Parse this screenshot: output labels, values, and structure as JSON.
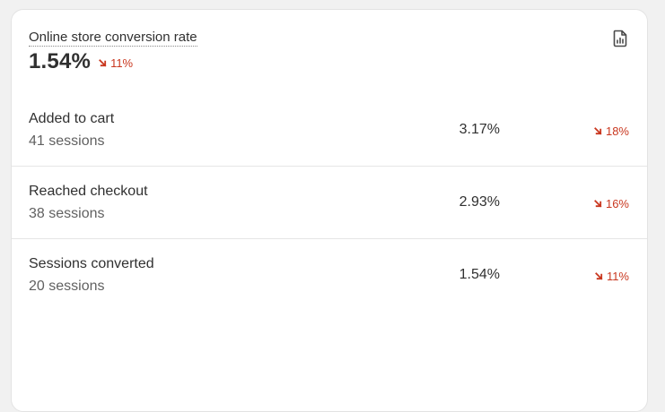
{
  "card": {
    "title": "Online store conversion rate",
    "value": "1.54%",
    "delta": "11%",
    "report_icon": "report-document-icon"
  },
  "rows": [
    {
      "label": "Added to cart",
      "sessions": "41 sessions",
      "value": "3.17%",
      "delta": "18%"
    },
    {
      "label": "Reached checkout",
      "sessions": "38 sessions",
      "value": "2.93%",
      "delta": "16%"
    },
    {
      "label": "Sessions converted",
      "sessions": "20 sessions",
      "value": "1.54%",
      "delta": "11%"
    }
  ],
  "colors": {
    "negative": "#c9371f",
    "text": "#303030",
    "subdued": "#616161"
  }
}
